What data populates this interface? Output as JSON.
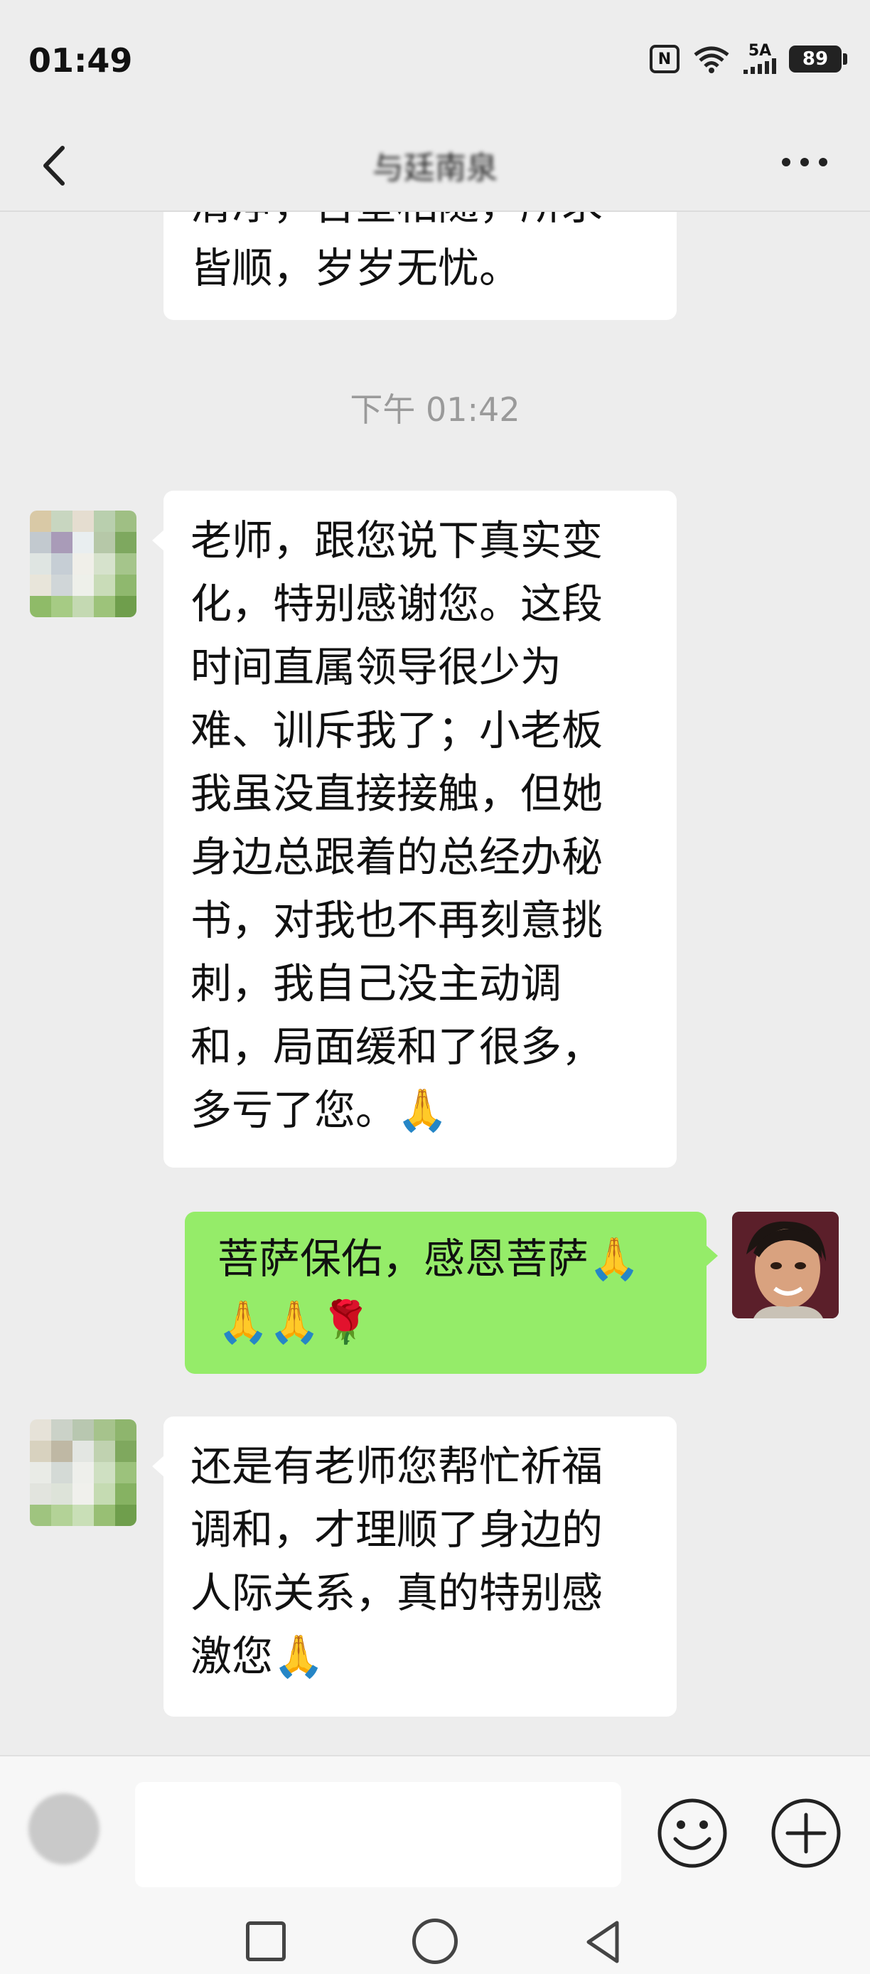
{
  "status": {
    "time": "01:49",
    "network": "5A",
    "battery": "89"
  },
  "header": {
    "title": "与廷南泉"
  },
  "messages": [
    {
      "side": "left",
      "text": "清净，吉星相随，所求\n皆顺，岁岁无忧。",
      "partial": true
    },
    {
      "timestamp": "下午 01:42"
    },
    {
      "side": "left",
      "text": "老师，跟您说下真实变\n化，特别感谢您。这段\n时间直属领导很少为\n难、训斥我了；小老板\n我虽没直接接触，但她\n身边总跟着的总经办秘\n书，对我也不再刻意挑\n刺，我自己没主动调\n和，局面缓和了很多，\n多亏了您。🙏"
    },
    {
      "side": "right",
      "text": "菩萨保佑，感恩菩萨🙏\n🙏🙏🌹"
    },
    {
      "side": "left",
      "text": "还是有老师您帮忙祈福\n调和，才理顺了身边的\n人际关系，真的特别感\n激您🙏"
    }
  ],
  "colors": {
    "self_bubble": "#95ec69",
    "other_bubble": "#ffffff",
    "background": "#ededed"
  }
}
